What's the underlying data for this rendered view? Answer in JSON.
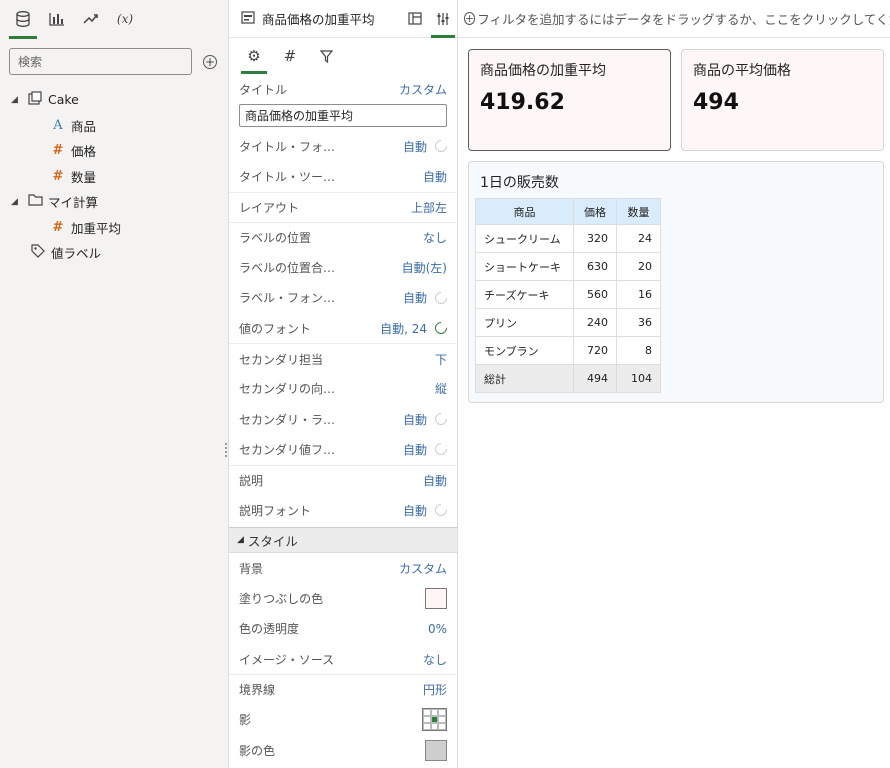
{
  "left_panel": {
    "tabs": [
      {
        "icon": "database-icon"
      },
      {
        "icon": "bar-chart-icon"
      },
      {
        "icon": "trend-icon"
      },
      {
        "icon": "formula-icon",
        "label": "(x)"
      }
    ],
    "search_placeholder": "検索",
    "tree": {
      "dataset": "Cake",
      "columns": [
        "商品",
        "価格",
        "数量"
      ],
      "folder": "マイ計算",
      "calc": "加重平均",
      "value_labels": "値ラベル"
    }
  },
  "properties": {
    "header_title": "商品価格の加重平均",
    "title_input": "商品価格の加重平均",
    "rows_general": [
      {
        "label": "タイトル",
        "value": "カスタム"
      },
      {
        "label": "タイトル・フォ…",
        "value": "自動",
        "reset": false
      },
      {
        "label": "タイトル・ツー…",
        "value": "自動"
      },
      {
        "label": "レイアウト",
        "value": "上部左"
      },
      {
        "label": "ラベルの位置",
        "value": "なし"
      },
      {
        "label": "ラベルの位置合…",
        "value": "自動(左)"
      },
      {
        "label": "ラベル・フォン…",
        "value": "自動",
        "reset": false
      },
      {
        "label": "値のフォント",
        "value": "自動, 24",
        "reset": true
      },
      {
        "label": "セカンダリ担当",
        "value": "下"
      },
      {
        "label": "セカンダリの向…",
        "value": "縦"
      },
      {
        "label": "セカンダリ・ラ…",
        "value": "自動",
        "reset": false
      },
      {
        "label": "セカンダリ値フ…",
        "value": "自動",
        "reset": false
      },
      {
        "label": "説明",
        "value": "自動"
      },
      {
        "label": "説明フォント",
        "value": "自動",
        "reset": false
      }
    ],
    "style_section": "スタイル",
    "style_rows": {
      "background": {
        "label": "背景",
        "value": "カスタム"
      },
      "fill_color": {
        "label": "塗りつぶしの色",
        "color": "#fff5f5"
      },
      "opacity": {
        "label": "色の透明度",
        "value": "0%"
      },
      "image_source": {
        "label": "イメージ・ソース",
        "value": "なし"
      },
      "border": {
        "label": "境界線",
        "value": "円形"
      },
      "shadow": {
        "label": "影"
      },
      "shadow_color": {
        "label": "影の色",
        "color": "#cfcfcf"
      }
    }
  },
  "canvas": {
    "filter_hint": "フィルタを追加するにはデータをドラッグするか、ここをクリックしてください",
    "tile1": {
      "title": "商品価格の加重平均",
      "value": "419.62"
    },
    "tile2": {
      "title": "商品の平均価格",
      "value": "494"
    },
    "table_tile": {
      "title": "1日の販売数",
      "headers": [
        "商品",
        "価格",
        "数量"
      ],
      "rows": [
        [
          "シュークリーム",
          "320",
          "24"
        ],
        [
          "ショートケーキ",
          "630",
          "20"
        ],
        [
          "チーズケーキ",
          "560",
          "16"
        ],
        [
          "プリン",
          "240",
          "36"
        ],
        [
          "モンブラン",
          "720",
          "8"
        ]
      ],
      "total": [
        "総計",
        "494",
        "104"
      ]
    }
  },
  "colors": {
    "accent": "#2f7d3a",
    "link": "#3d6da8",
    "tile_bg": "#fff7f7"
  }
}
